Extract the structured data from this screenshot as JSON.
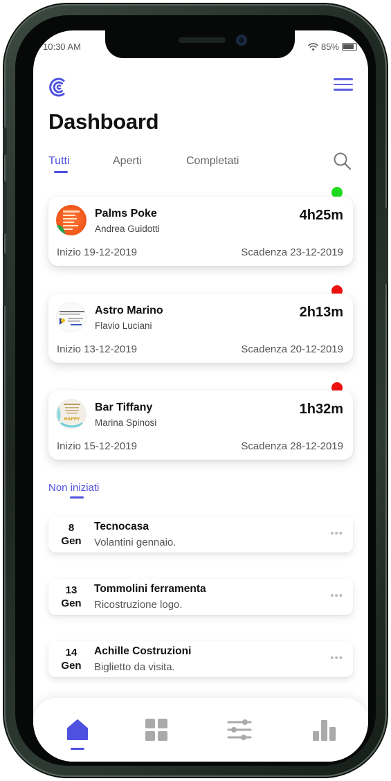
{
  "colors": {
    "accent": "#4e51e0",
    "status_green": "#1fdc1f",
    "status_red": "#ee1111"
  },
  "status_bar": {
    "time": "10:30 AM",
    "battery": "85%"
  },
  "header": {
    "title": "Dashboard",
    "logo_icon": "logo-c-icon",
    "menu_icon": "hamburger-menu-icon"
  },
  "tabs": [
    {
      "label": "Tutti",
      "active": true
    },
    {
      "label": "Aperti",
      "active": false
    },
    {
      "label": "Completati",
      "active": false
    }
  ],
  "search_icon": "search-icon",
  "active_projects": [
    {
      "name": "Palms Poke",
      "person": "Andrea Guidotti",
      "time": "4h25m",
      "start": "Inizio 19-12-2019",
      "due": "Scadenza 23-12-2019",
      "status_color": "#1fdc1f"
    },
    {
      "name": "Astro Marino",
      "person": "Flavio Luciani",
      "time": "2h13m",
      "start": "Inizio 13-12-2019",
      "due": "Scadenza 20-12-2019",
      "status_color": "#ee1111"
    },
    {
      "name": "Bar Tiffany",
      "person": "Marina Spinosi",
      "time": "1h32m",
      "start": "Inizio 15-12-2019",
      "due": "Scadenza 28-12-2019",
      "status_color": "#ee1111"
    }
  ],
  "section": {
    "title": "Non iniziati"
  },
  "not_started": [
    {
      "day": "8",
      "month": "Gen",
      "title": "Tecnocasa",
      "subtitle": "Volantini gennaio.",
      "more": "•••"
    },
    {
      "day": "13",
      "month": "Gen",
      "title": "Tommolini ferramenta",
      "subtitle": "Ricostruzione logo.",
      "more": "•••"
    },
    {
      "day": "14",
      "month": "Gen",
      "title": "Achille Costruzioni",
      "subtitle": "Biglietto da visita.",
      "more": "•••"
    }
  ],
  "bottom_nav": [
    {
      "icon": "home-icon",
      "active": true
    },
    {
      "icon": "grid-icon",
      "active": false
    },
    {
      "icon": "sliders-icon",
      "active": false
    },
    {
      "icon": "bar-chart-icon",
      "active": false
    }
  ]
}
